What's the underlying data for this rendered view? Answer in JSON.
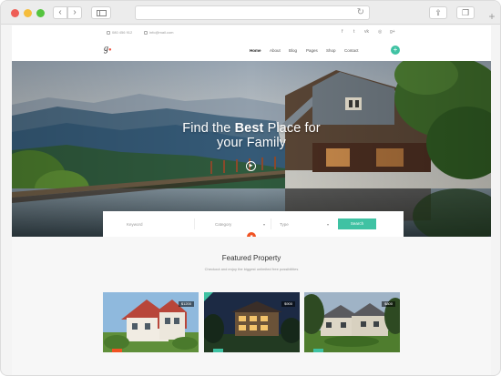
{
  "browser": {
    "back_glyph": "‹",
    "forward_glyph": "›",
    "reload_glyph": "↻",
    "share_glyph": "⇪",
    "tabs_glyph": "❐",
    "new_tab_glyph": "+"
  },
  "topbar": {
    "phone": "080 456 912",
    "email": "info@mail.com",
    "social_icons": [
      "facebook-icon",
      "twitter-icon",
      "vk-icon",
      "instagram-icon",
      "google-plus-icon"
    ],
    "social_glyphs": [
      "f",
      "t",
      "vk",
      "◎",
      "g+"
    ]
  },
  "header": {
    "logo": "g",
    "logo_mark": "●",
    "menu": [
      "Home",
      "About",
      "Blog",
      "Pages",
      "Shop",
      "Contact"
    ],
    "add_glyph": "+"
  },
  "hero": {
    "line1_pre": "Find the ",
    "line1_bold": "Best",
    "line1_post": " Place for",
    "line2": "your Family",
    "play_glyph": "▶"
  },
  "search": {
    "keyword_placeholder": "Keyword",
    "category_label": "Category",
    "type_label": "Type",
    "caret": "▾",
    "button_label": "Search",
    "scroll_glyph": "■"
  },
  "featured": {
    "title": "Featured Property",
    "subtitle": "Checkout and enjoy the biggest unlimited free possibilities",
    "cards": [
      {
        "price": "$1200"
      },
      {
        "price": "$900"
      },
      {
        "price": "$800"
      }
    ]
  },
  "colors": {
    "accent": "#3fc2a3",
    "orange": "#f05323"
  }
}
